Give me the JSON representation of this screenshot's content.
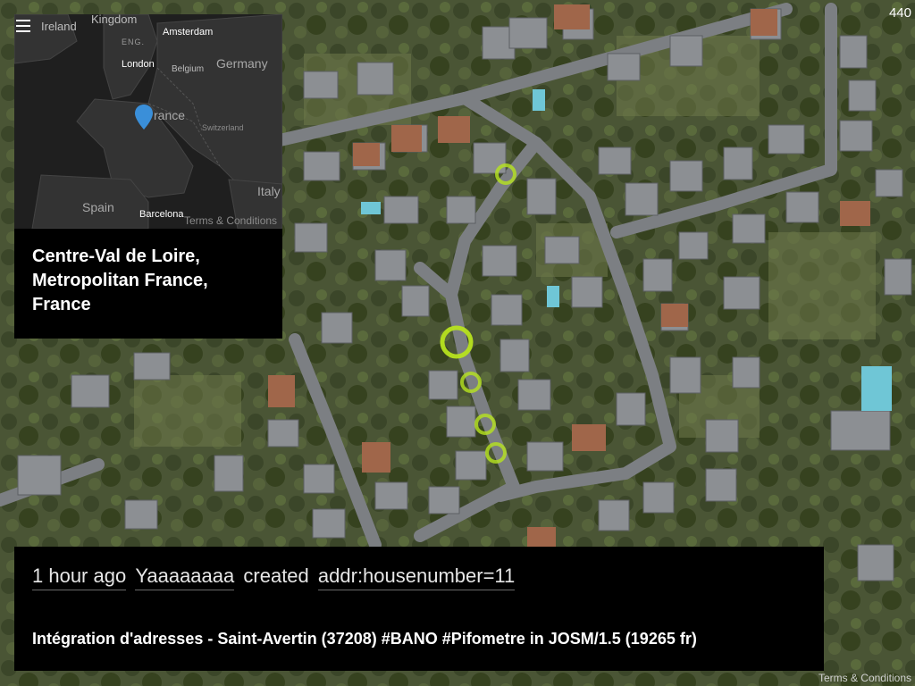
{
  "top_counter": "440",
  "inset": {
    "labels": {
      "ireland": "Ireland",
      "kingdom": "Kingdom",
      "eng": "ENG.",
      "amsterdam": "Amsterdam",
      "london": "London",
      "belgium": "Belgium",
      "germany": "Germany",
      "france": "rance",
      "switzerland": "Switzerland",
      "italy": "Italy",
      "spain": "Spain",
      "barcelona": "Barcelona"
    },
    "terms": "Terms & Conditions",
    "location": "Centre-Val de Loire, Metropolitan France, France",
    "marker_color": "#3a8fd9"
  },
  "event": {
    "time": "1 hour ago",
    "user": "Yaaaaaaaa",
    "action": "created",
    "tag": "addr:housenumber=11",
    "comment": "Intégration d'adresses - Saint-Avertin (37208) #BANO #Pifometre in JOSM/1.5 (19265 fr)"
  },
  "map_terms": "Terms & Conditions",
  "colors": {
    "ring": "#b7e31f",
    "road": "#7c7f83",
    "panel": "#000000"
  }
}
